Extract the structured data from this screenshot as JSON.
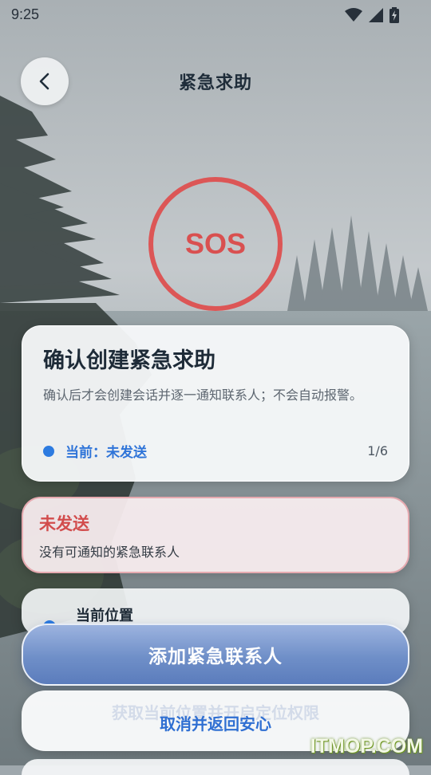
{
  "status_bar": {
    "time": "9:25",
    "icons": [
      "wifi-icon",
      "cellular-signal-icon",
      "battery-charging-icon"
    ]
  },
  "header": {
    "title": "紧急求助",
    "back_icon": "chevron-left-icon"
  },
  "sos": {
    "label": "SOS",
    "ring_color": "#dc5656"
  },
  "confirm_card": {
    "title": "确认创建紧急求助",
    "description": "确认后才会创建会话并逐一通知联系人；不会自动报警。",
    "status_label": "当前：未发送",
    "step": "1/6",
    "accent_color": "#2f74d8"
  },
  "error_card": {
    "title": "未发送",
    "message": "没有可通知的紧急联系人",
    "color": "#d24c4c"
  },
  "location_card": {
    "title": "当前位置"
  },
  "actions": {
    "primary_label": "添加紧急联系人",
    "hidden_label": "获取当前位置并开启定位权限",
    "secondary_label": "取消并返回安心"
  },
  "watermark": "ITMOP.COM"
}
